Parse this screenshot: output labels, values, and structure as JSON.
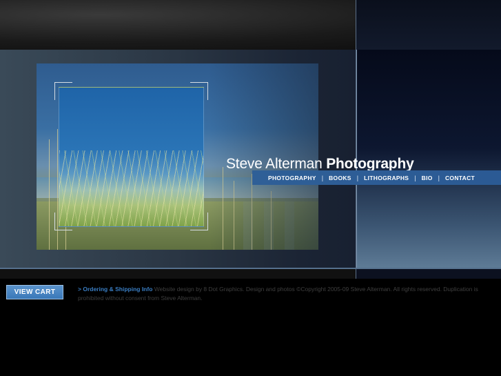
{
  "header": {
    "site_title_light": "Steve Alterman",
    "site_title_bold": "Photography"
  },
  "nav": {
    "items": [
      {
        "label": "PHOTOGRAPHY"
      },
      {
        "label": "BOOKS"
      },
      {
        "label": "LITHOGRAPHS"
      },
      {
        "label": "BIO"
      },
      {
        "label": "CONTACT"
      }
    ],
    "separator": "|"
  },
  "footer": {
    "view_cart_label": "VIEW CART",
    "arrow": ">",
    "ordering_link": "Ordering & Shipping Info",
    "credit_text": "Website design by 8 Dot Graphics. Design and photos ©Copyright 2005-09 Steve Alterman. All rights reserved. Duplication is prohibited without consent from Steve Alterman."
  },
  "colors": {
    "accent_blue": "#3a7ec4",
    "nav_bar": "#2f5f97",
    "background": "#000000"
  }
}
